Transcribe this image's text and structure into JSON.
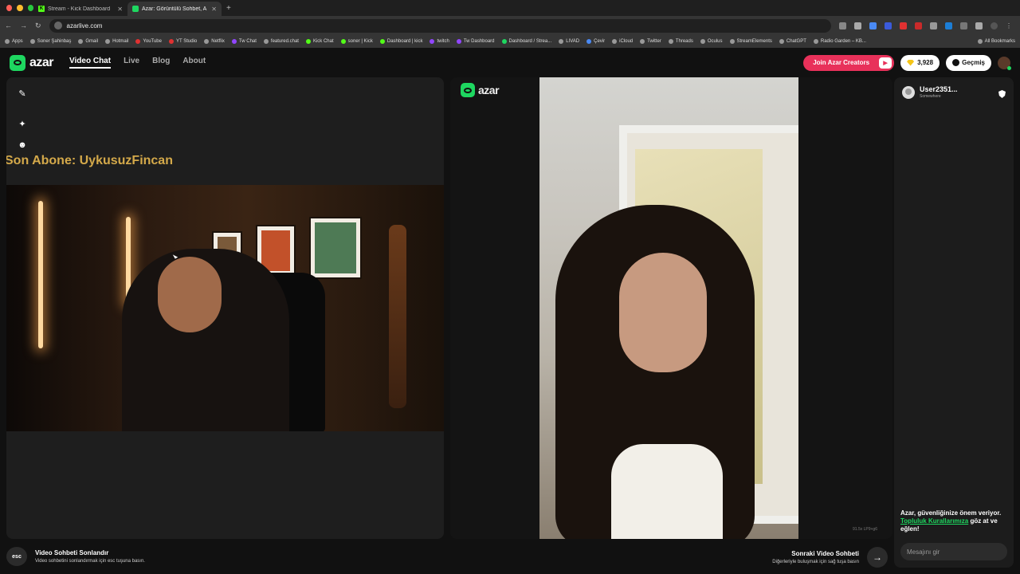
{
  "browser": {
    "tabs": [
      {
        "title": "Stream - Kick Dashboard"
      },
      {
        "title": "Azar: Görüntülü Sohbet, A"
      }
    ],
    "new_tab": "+",
    "address": "azarlive.com",
    "bookmarks": [
      "Apps",
      "Soner Şahinbaş",
      "Gmail",
      "Hotmail",
      "YouTube",
      "YT Studio",
      "Netflix",
      "Tw Chat",
      "featured.chat",
      "Kick Chat",
      "soner | Kick",
      "Dashboard | kick",
      "twitch",
      "Tw Dashboard",
      "Dashboard / Strea...",
      "LIVAD",
      "Çevir",
      "iCloud",
      "Twitter",
      "Threads",
      "Oculus",
      "StreamElements",
      "ChatGPT",
      "Radio Garden – KB..."
    ],
    "all_bookmarks": "All Bookmarks"
  },
  "header": {
    "logo": "azar",
    "nav": [
      "Video Chat",
      "Live",
      "Blog",
      "About"
    ],
    "creators_button": "Join Azar Creators",
    "gems": "3,928",
    "history": "Geçmiş"
  },
  "left": {
    "overlay_text": "Son Abone: UykusuzFincan"
  },
  "center": {
    "logo": "azar",
    "codec": "91.5x LP9+g6"
  },
  "partner": {
    "name": "User2351...",
    "location": "Somewhere"
  },
  "safety": {
    "text_before": "Azar, güvenliğinize önem veriyor.",
    "link": "Topluluk Kurallarımıza",
    "text_after": "göz at ve eğlen!"
  },
  "chat": {
    "placeholder": "Mesajını gir"
  },
  "footer": {
    "esc_key": "esc",
    "end_title": "Video Sohbeti Sonlandır",
    "end_sub": "Video sohbetini sonlandırmak için esc tuşuna basın.",
    "next_title": "Sonraki Video Sohbeti",
    "next_sub": "Diğerleriyle buluşmak için sağ tuşa basın"
  },
  "colors": {
    "brand_green": "#1ed760",
    "creators_red": "#e8315a",
    "overlay_gold": "#d4a94a"
  }
}
